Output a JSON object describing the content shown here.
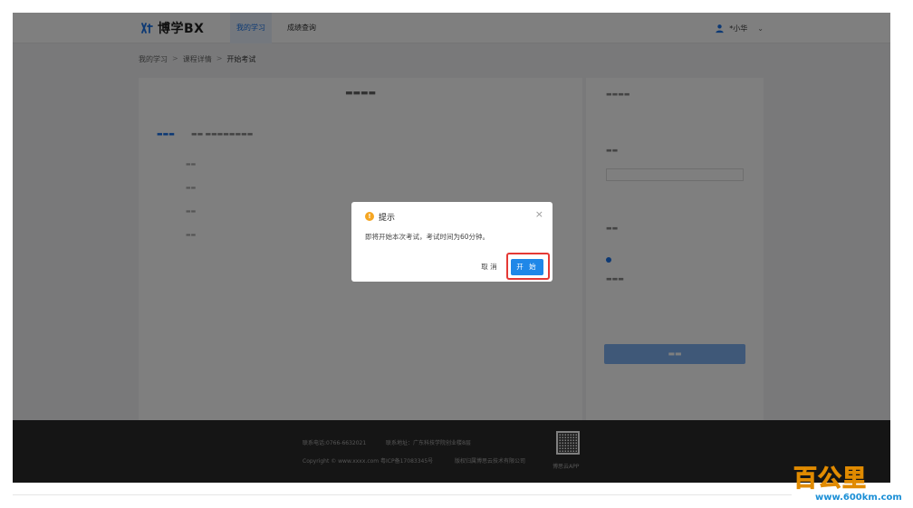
{
  "header": {
    "brand": "博学BX",
    "nav": [
      "我的学习",
      "成绩查询"
    ],
    "user": "*小华"
  },
  "breadcrumb": {
    "items": [
      "我的学习",
      "课程详情"
    ],
    "separator": ">",
    "current": "开始考试"
  },
  "modal": {
    "title": "提示",
    "message": "即将开始本次考试，考试时间为60分钟。",
    "cancel_label": "取 消",
    "start_label": "开 始",
    "close_symbol": "×",
    "warn_symbol": "!"
  },
  "footer": {
    "phone_line": "联系电话:0766-6632021",
    "address_line": "联系地址：广东科技学院创业楼8层",
    "copyright_line": "Copyright © www.xxxx.com 粤ICP备17083345号",
    "company_line": "版权归属博思云技术有限公司",
    "app_label": "博思云APP"
  },
  "watermark": {
    "text": "百公里",
    "url": "www.600km.com"
  },
  "colors": {
    "accent": "#1f87e8",
    "warning": "#f5a623",
    "highlight": "#e53935",
    "overlay": "rgba(0,0,0,0.5)"
  }
}
